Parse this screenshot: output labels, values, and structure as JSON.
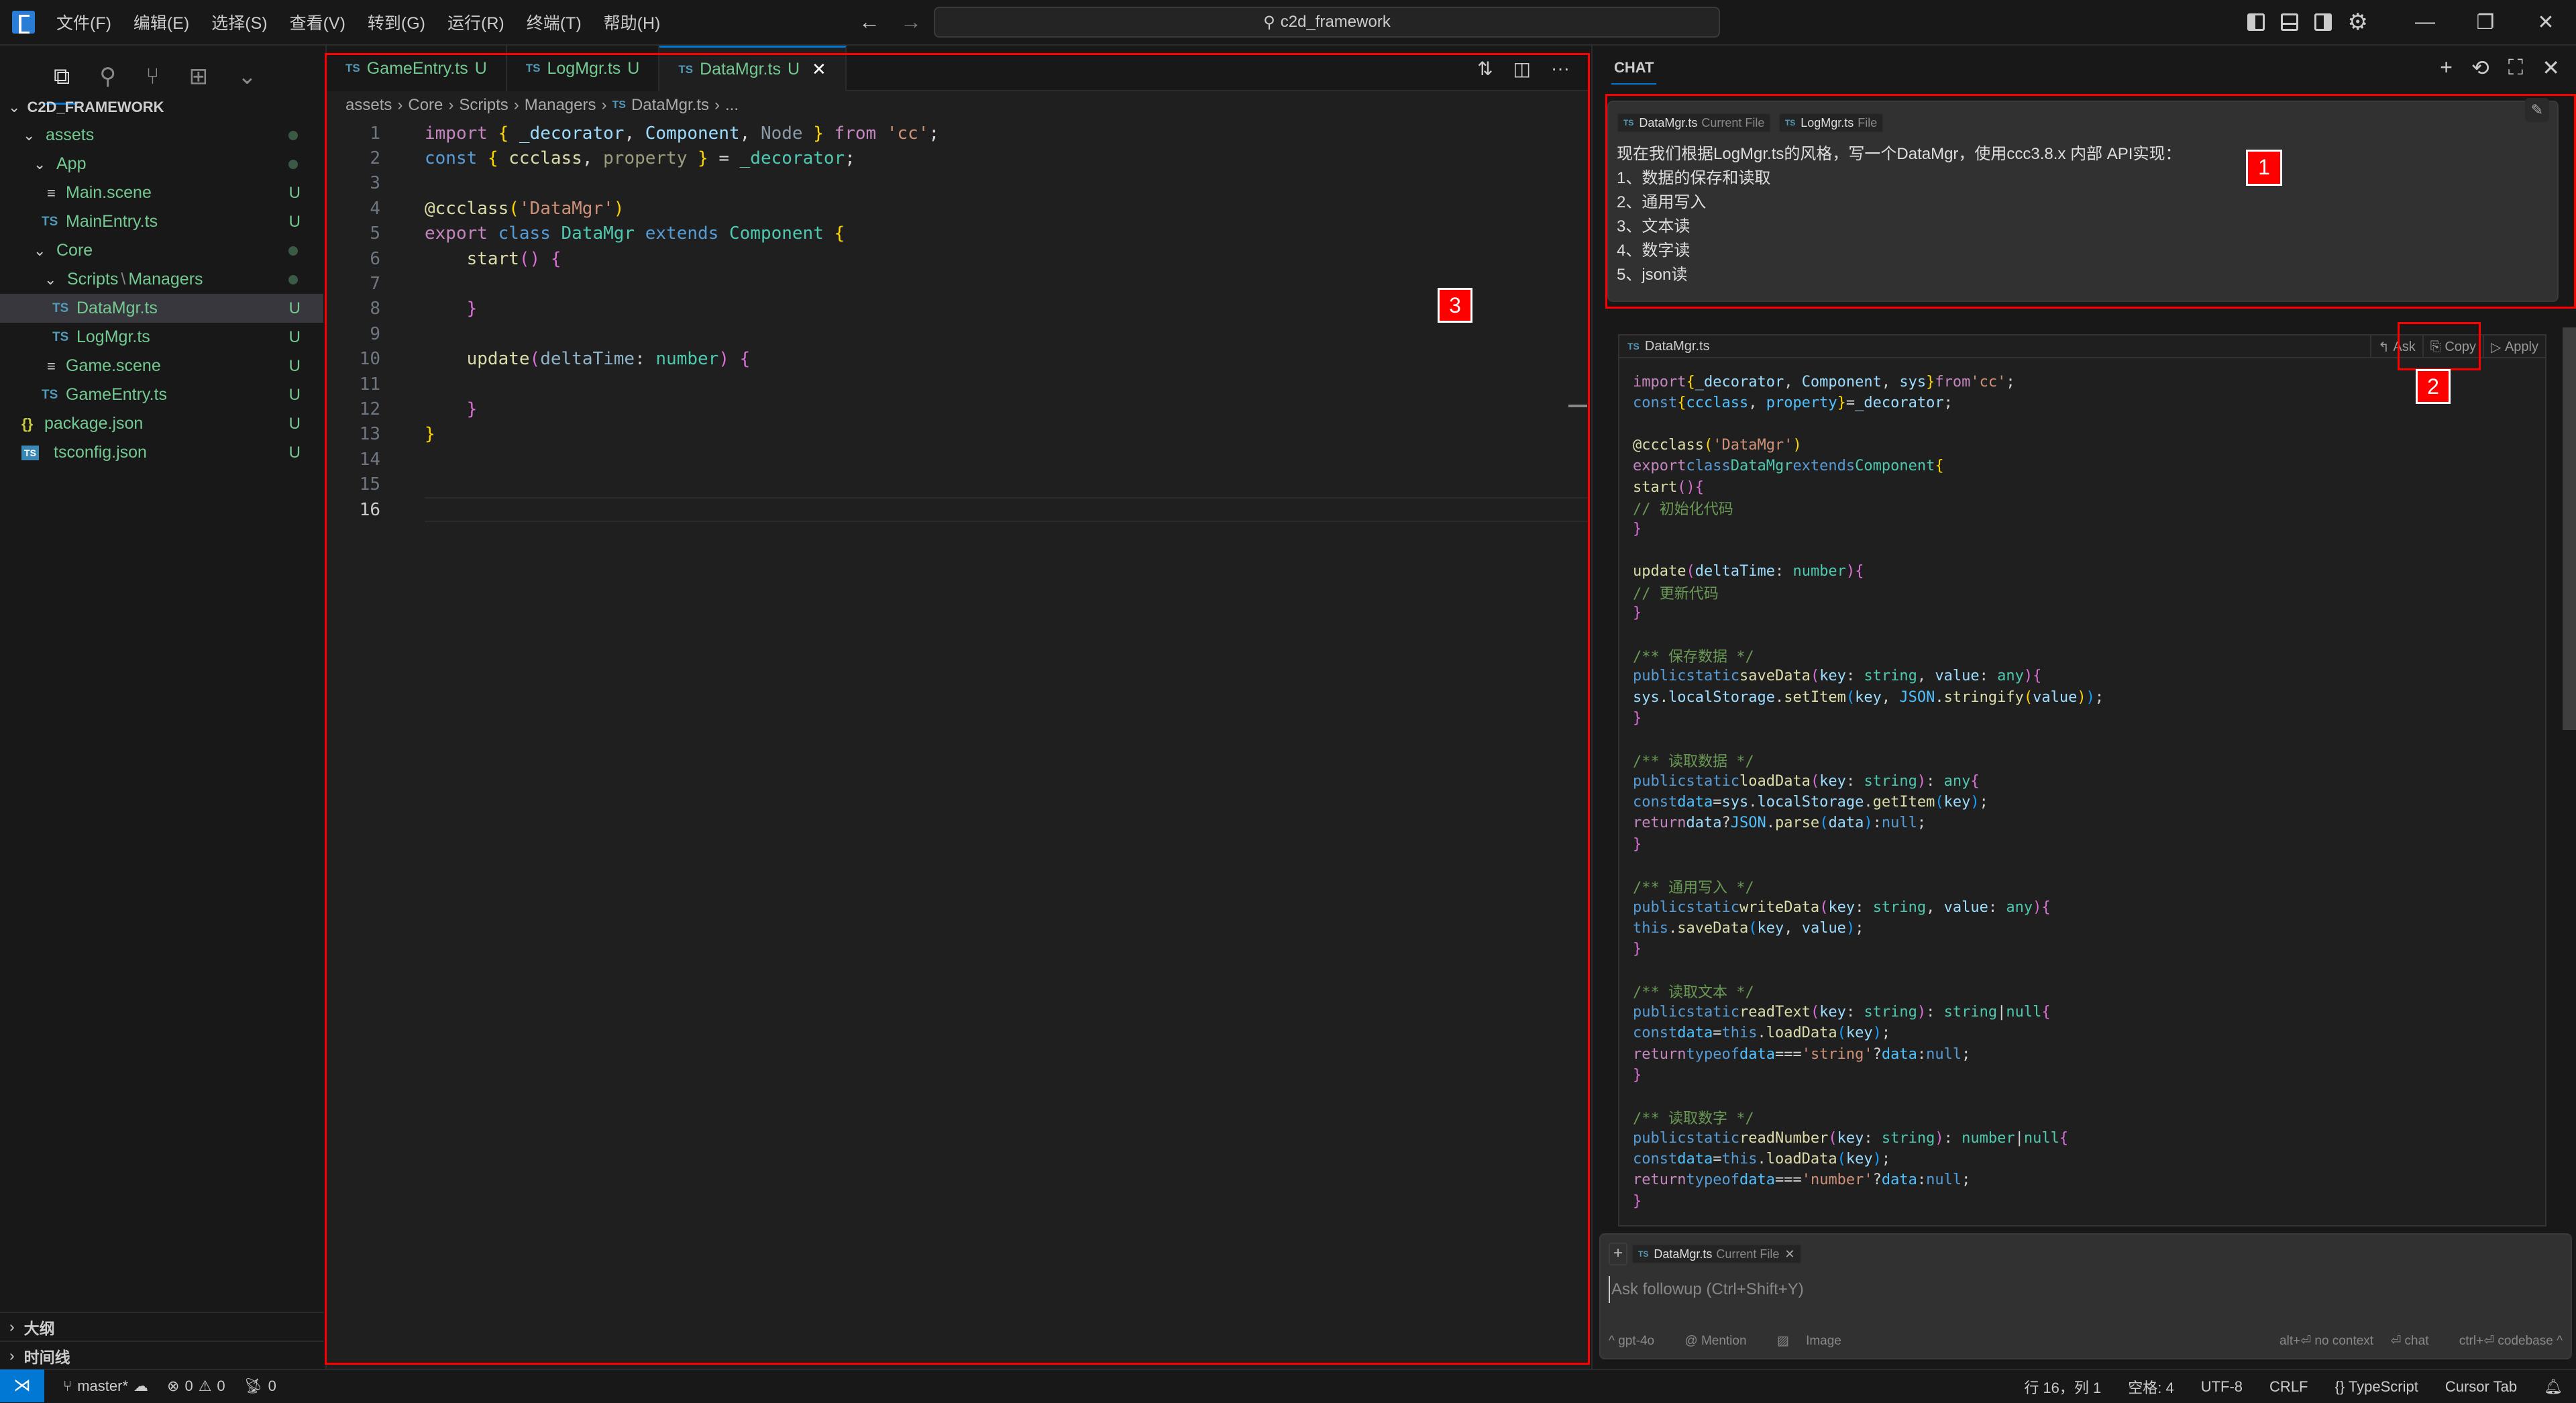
{
  "titlebar": {
    "menu": [
      "文件(F)",
      "编辑(E)",
      "选择(S)",
      "查看(V)",
      "转到(G)",
      "运行(R)",
      "终端(T)",
      "帮助(H)"
    ],
    "search": "c2d_framework",
    "icons": [
      "toggle-primary-sidebar-icon",
      "toggle-panel-icon",
      "toggle-secondary-sidebar-icon",
      "gear-icon",
      "minimize-icon",
      "restore-icon",
      "close-icon"
    ]
  },
  "explorer": {
    "root": "C2D_FRAMEWORK",
    "items": [
      {
        "label": "assets",
        "type": "folder",
        "status": "dot"
      },
      {
        "label": "App",
        "type": "folder",
        "status": "dot"
      },
      {
        "label": "Main.scene",
        "type": "scene",
        "status": "U"
      },
      {
        "label": "MainEntry.ts",
        "type": "ts",
        "status": "U"
      },
      {
        "label": "Core",
        "type": "folder",
        "status": "dot"
      },
      {
        "label": "Scripts",
        "label2": "Managers",
        "type": "folder",
        "status": "dot"
      },
      {
        "label": "DataMgr.ts",
        "type": "ts",
        "status": "U",
        "selected": true
      },
      {
        "label": "LogMgr.ts",
        "type": "ts",
        "status": "U"
      },
      {
        "label": "Game.scene",
        "type": "scene",
        "status": "U"
      },
      {
        "label": "GameEntry.ts",
        "type": "ts",
        "status": "U"
      },
      {
        "label": "package.json",
        "type": "json",
        "status": "U"
      },
      {
        "label": "tsconfig.json",
        "type": "tsconfig",
        "status": "U"
      }
    ],
    "panels": [
      "大纲",
      "时间线"
    ]
  },
  "editor": {
    "tabs": [
      {
        "label": "GameEntry.ts",
        "badge": "U",
        "active": false
      },
      {
        "label": "LogMgr.ts",
        "badge": "U",
        "active": false
      },
      {
        "label": "DataMgr.ts",
        "badge": "U",
        "active": true
      }
    ],
    "breadcrumb": [
      "assets",
      "Core",
      "Scripts",
      "Managers",
      "DataMgr.ts",
      "..."
    ],
    "file_icon": "TS",
    "current_line": 16
  },
  "chat": {
    "title": "CHAT",
    "user_message": {
      "chips": [
        {
          "name": "DataMgr.ts",
          "sub": "Current File"
        },
        {
          "name": "LogMgr.ts",
          "sub": "File"
        }
      ],
      "lines": [
        "现在我们根据LogMgr.ts的风格，写一个DataMgr，使用ccc3.8.x 内部 API实现：",
        "1、数据的保存和读取",
        "2、通用写入",
        "3、文本读",
        "4、数字读",
        "5、json读"
      ]
    },
    "code_block": {
      "filename": "DataMgr.ts",
      "actions": [
        "Ask",
        "Copy",
        "Apply"
      ]
    },
    "composer": {
      "chip": {
        "name": "DataMgr.ts",
        "sub": "Current File"
      },
      "placeholder": "Ask followup (Ctrl+Shift+Y)",
      "model": "gpt-4o",
      "mention": "Mention",
      "image": "Image",
      "hints": [
        "alt+⏎ no context",
        "⏎ chat",
        "ctrl+⏎ codebase"
      ]
    }
  },
  "annotations": [
    "1",
    "2",
    "3"
  ],
  "statusbar": {
    "branch": "master*",
    "errors": "0",
    "warnings": "0",
    "ports": "0",
    "position": "行 16，列 1",
    "spaces": "空格: 4",
    "encoding": "UTF-8",
    "eol": "CRLF",
    "language": "TypeScript",
    "cursor_tab": "Cursor Tab"
  }
}
